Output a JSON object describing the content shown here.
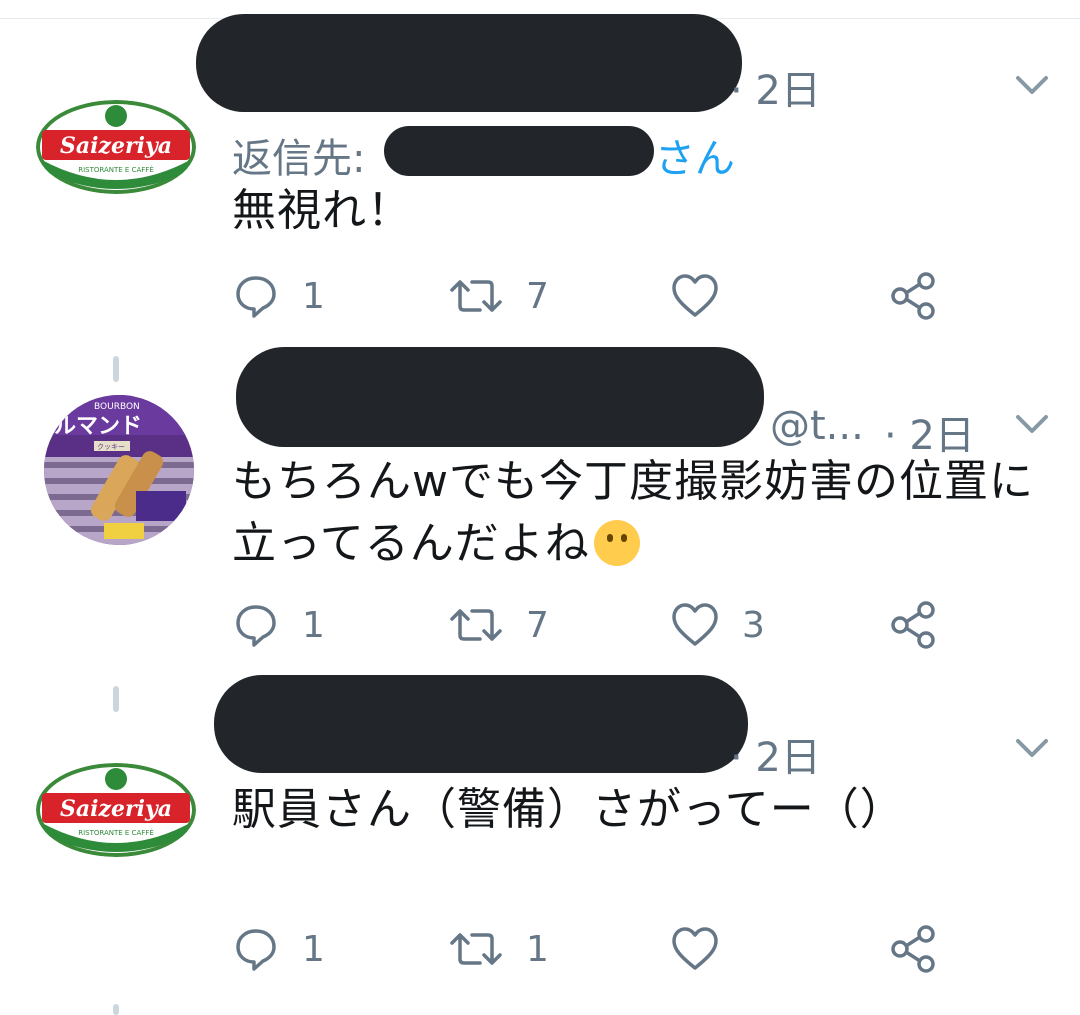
{
  "tweets": [
    {
      "avatar": "saizeriya-logo",
      "time": "· 2日",
      "reply_to_label": "返信先:",
      "reply_to_suffix": "さん",
      "body": "無視れ！",
      "replies": "1",
      "retweets": "7",
      "likes": ""
    },
    {
      "avatar": "lumonde-cookie-photo",
      "handle_fragment": "@t...",
      "time": "· 2日",
      "body_line1": "もちろんwでも今丁度撮影妨害の位置に",
      "body_line2": "立ってるんだよね",
      "emoji": "thinking-face",
      "replies": "1",
      "retweets": "7",
      "likes": "3"
    },
    {
      "avatar": "saizeriya-logo",
      "time": "· 2日",
      "body": "駅員さん（警備）さがってー（）",
      "replies": "1",
      "retweets": "1",
      "likes": ""
    }
  ],
  "logo": {
    "name": "Saizeriya",
    "tagline": "RISTORANTE E CAFFÈ"
  },
  "snack": {
    "brand": "BOURBON",
    "name": "ルマンド",
    "sub": "クッキー"
  },
  "colors": {
    "gray": "#657786",
    "link": "#1da1f2",
    "redact": "#22262b"
  }
}
